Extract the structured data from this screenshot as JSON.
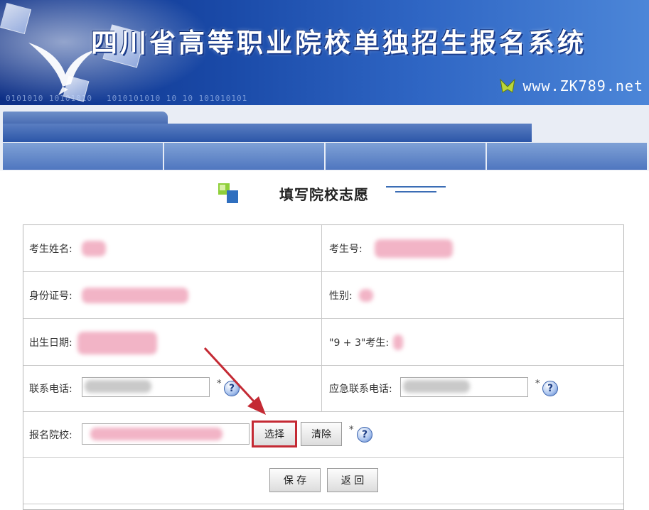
{
  "banner": {
    "title": "四川省高等职业院校单独招生报名系统",
    "site": "www.ZK789.net",
    "binary_1": "0101010 10101010",
    "binary_2": "1010101010   10 10 101010101"
  },
  "page": {
    "heading": "填写院校志愿"
  },
  "form": {
    "name_label": "考生姓名:",
    "exam_no_label": "考生号:",
    "id_label": "身份证号:",
    "gender_label": "性别:",
    "birth_label": "出生日期:",
    "nine_three_label": "\"9 + 3\"考生:",
    "phone_label": "联系电话:",
    "emergency_label": "应急联系电话:",
    "school_label": "报名院校:",
    "required_mark": "*",
    "help_glyph": "?",
    "select_button": "选择",
    "clear_button": "清除",
    "save_button": "保 存",
    "back_button": "返 回"
  },
  "colors": {
    "banner": "#1a4aa8",
    "nav": "#4f76bf",
    "highlight": "#c42a34",
    "redacted": "#f2b4c6"
  },
  "icons": [
    "bird-icon",
    "site-logo-icon",
    "heading-cube-icon",
    "help-icon",
    "annotation-arrow"
  ]
}
